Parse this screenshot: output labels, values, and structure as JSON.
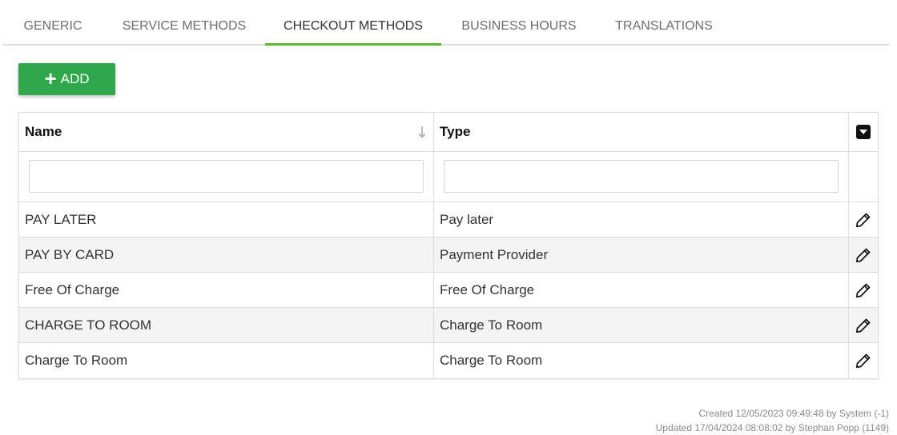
{
  "tabs": [
    {
      "label": "GENERIC",
      "active": false
    },
    {
      "label": "SERVICE METHODS",
      "active": false
    },
    {
      "label": "CHECKOUT METHODS",
      "active": true
    },
    {
      "label": "BUSINESS HOURS",
      "active": false
    },
    {
      "label": "TRANSLATIONS",
      "active": false
    }
  ],
  "toolbar": {
    "add_label": "ADD",
    "add_icon": "plus-icon"
  },
  "table": {
    "columns": [
      {
        "label": "Name",
        "sort": "ascending"
      },
      {
        "label": "Type"
      }
    ],
    "filters": {
      "name_value": "",
      "type_value": ""
    },
    "rows": [
      {
        "name": "PAY LATER",
        "type": "Pay later"
      },
      {
        "name": "PAY BY CARD",
        "type": "Payment Provider"
      },
      {
        "name": "Free Of Charge",
        "type": "Free Of Charge"
      },
      {
        "name": "CHARGE TO ROOM",
        "type": "Charge To Room"
      },
      {
        "name": "Charge To Room",
        "type": "Charge To Room"
      }
    ]
  },
  "footer": {
    "created": "Created 12/05/2023 09:49:48 by System (-1)",
    "updated": "Updated 17/04/2024 08:08:02 by Stephan Popp (1149)"
  },
  "colors": {
    "accent": "#5cb833",
    "add_button": "#2ea84a"
  }
}
